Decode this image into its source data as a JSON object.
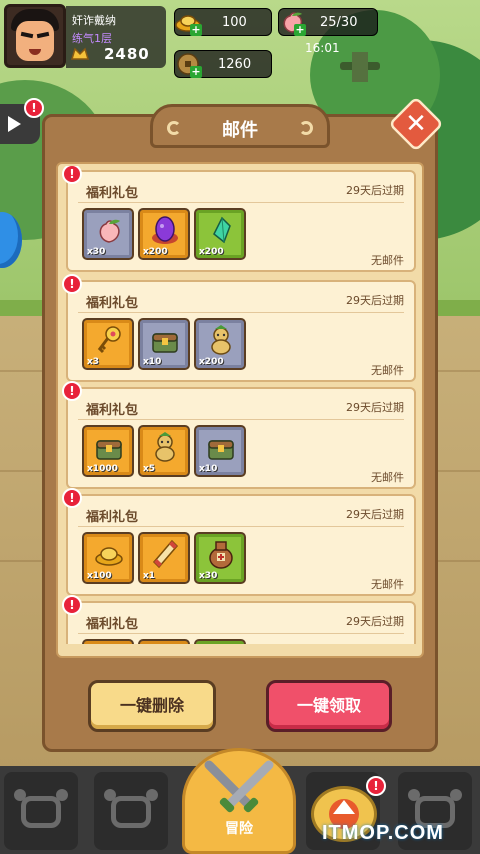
{
  "player": {
    "name": "奸诈戴纳",
    "rank": "练气1层",
    "power": "2480"
  },
  "resources": {
    "gold": "100",
    "coins": "1260",
    "stamina": "25/30",
    "stamina_timer": "16:01"
  },
  "mail": {
    "title": "邮件",
    "items": [
      {
        "title": "福利礼包",
        "expire": "29天后过期",
        "status": "无邮件",
        "rewards": [
          {
            "icon": "peach-icon",
            "count": "x30",
            "rarity": "gray"
          },
          {
            "icon": "purple-egg-icon",
            "count": "x200",
            "rarity": "orange"
          },
          {
            "icon": "green-crystal-icon",
            "count": "x200",
            "rarity": "green"
          }
        ]
      },
      {
        "title": "福利礼包",
        "expire": "29天后过期",
        "status": "无邮件",
        "rewards": [
          {
            "icon": "gold-key-icon",
            "count": "x3",
            "rarity": "orange"
          },
          {
            "icon": "treasure-chest-icon",
            "count": "x10",
            "rarity": "gray"
          },
          {
            "icon": "gourd-doll-icon",
            "count": "x200",
            "rarity": "gray"
          }
        ]
      },
      {
        "title": "福利礼包",
        "expire": "29天后过期",
        "status": "无邮件",
        "rewards": [
          {
            "icon": "treasure-chest-icon",
            "count": "x1000",
            "rarity": "orange"
          },
          {
            "icon": "gourd-doll-icon",
            "count": "x5",
            "rarity": "orange"
          },
          {
            "icon": "treasure-chest-icon",
            "count": "x10",
            "rarity": "gray"
          }
        ]
      },
      {
        "title": "福利礼包",
        "expire": "29天后过期",
        "status": "无邮件",
        "rewards": [
          {
            "icon": "gold-ingot-icon",
            "count": "x100",
            "rarity": "orange"
          },
          {
            "icon": "scroll-icon",
            "count": "x1",
            "rarity": "orange"
          },
          {
            "icon": "wine-jar-icon",
            "count": "x30",
            "rarity": "green"
          }
        ]
      },
      {
        "title": "福利礼包",
        "expire": "29天后过期",
        "status": "",
        "rewards": []
      }
    ]
  },
  "buttons": {
    "delete_all": "一键删除",
    "claim_all": "一键领取"
  },
  "nav": {
    "adventure": "冒险"
  },
  "badge_mark": "!",
  "watermark": "ITMOP.COM"
}
